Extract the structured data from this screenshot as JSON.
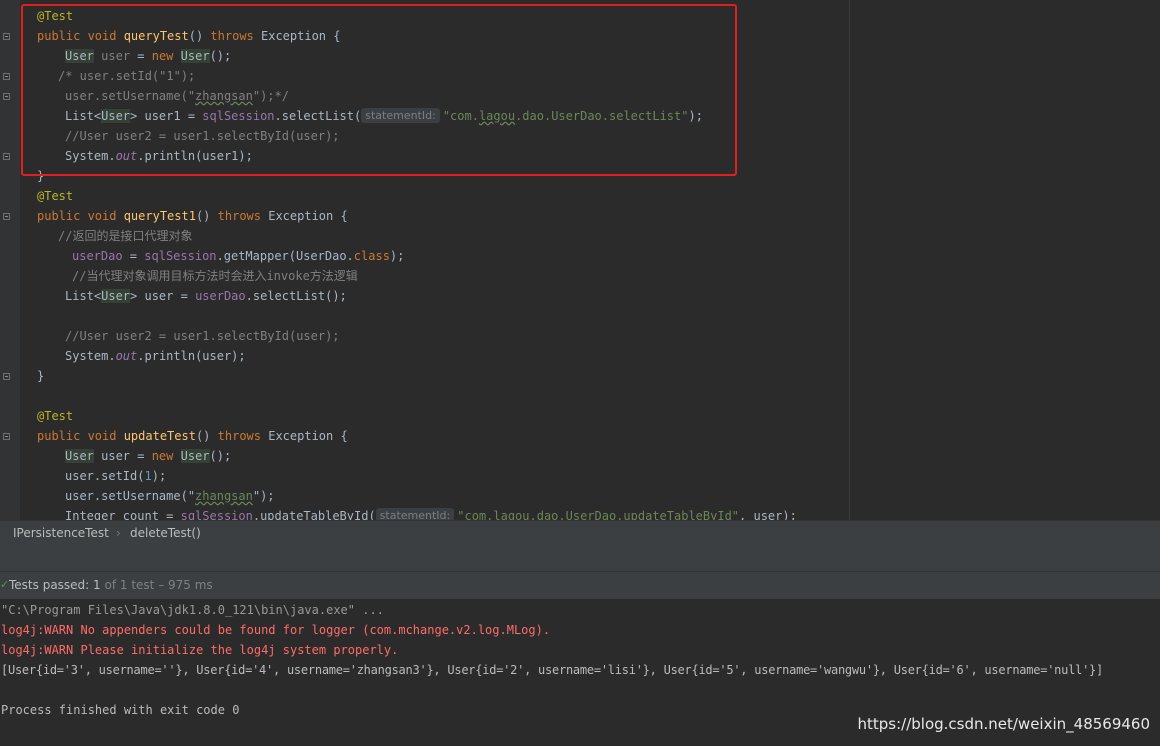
{
  "editor": {
    "lines": {
      "l0": {
        "ann": "@Test"
      },
      "l1": {
        "kw1": "public void ",
        "fn": "queryTest",
        "a": "() ",
        "kw2": "throws",
        "b": " Exception {"
      },
      "l2": {
        "t1": "User",
        "sp": " ",
        "v": "user",
        "eq": " = ",
        "kw": "new",
        "sp2": " ",
        "t2": "User",
        "end": "();"
      },
      "l3": {
        "c": "/* user.setId(\"1\");"
      },
      "l4": {
        "c1": "user.setUsername(\"",
        "s": "zhangsan",
        "c2": "\");*/"
      },
      "l5": {
        "a": "List<",
        "t": "User",
        "b": "> user1 = ",
        "sq": "sqlSession",
        "c": ".selectList(",
        "hint": "statementId:",
        "q1": "\"",
        "s1": "com.",
        "s2": "lagou",
        "s3": ".dao.UserDao.selectList\"",
        "end": ");"
      },
      "l6": {
        "c": "//User user2 = user1.selectById(user);"
      },
      "l7": {
        "a": "System.",
        "f": "out",
        "b": ".println(user1);"
      },
      "l8": {
        "t": "}"
      },
      "l9": {
        "ann": "@Test"
      },
      "l10": {
        "kw1": "public void ",
        "fn": "queryTest1",
        "a": "() ",
        "kw2": "throws",
        "b": " Exception {"
      },
      "l11": {
        "c": "//返回的是接口代理对象"
      },
      "l12": {
        "v1": "userDao",
        "eq": " = ",
        "v2": "sqlSession",
        "m": ".getMapper(UserDao.",
        "kw": "class",
        "end": ");"
      },
      "l13": {
        "c": "//当代理对象调用目标方法时会进入invoke方法逻辑"
      },
      "l14": {
        "a": "List<",
        "t": "User",
        "b": "> user = ",
        "v": "userDao",
        "c": ".selectList();"
      },
      "l16": {
        "c": "//User user2 = user1.selectById(user);"
      },
      "l17": {
        "a": "System.",
        "f": "out",
        "b": ".println(user);"
      },
      "l18": {
        "t": "}"
      },
      "l20": {
        "ann": "@Test"
      },
      "l21": {
        "kw1": "public void ",
        "fn": "updateTest",
        "a": "() ",
        "kw2": "throws",
        "b": " Exception {"
      },
      "l22": {
        "t1": "User",
        "a": " user = ",
        "kw": "new",
        "sp": " ",
        "t2": "User",
        "end": "();"
      },
      "l23": {
        "a": "user.setId(",
        "n": "1",
        "end": ");"
      },
      "l24": {
        "a": "user.setUsername(\"",
        "s": "zhangsan",
        "end": "\");"
      },
      "l25": {
        "a": "Integer count = ",
        "sq": "sqlSession",
        "b": ".updateTableById(",
        "hint": "statementId:",
        "s1": "\"com.",
        "s2": "lagou",
        "s3": ".dao.UserDao.updateTableById\"",
        "end": ", user);"
      }
    }
  },
  "breadcrumb": {
    "class_name": "IPersistenceTest",
    "separator": "›",
    "method_name": "deleteTest()"
  },
  "tests": {
    "check_icon": "✓",
    "label": "Tests passed: ",
    "passed": "1",
    "total": "of 1 test",
    "dash": " – ",
    "time": "975 ms"
  },
  "console": {
    "line1": "\"C:\\Program Files\\Java\\jdk1.8.0_121\\bin\\java.exe\" ...",
    "line2": "log4j:WARN No appenders could be found for logger (com.mchange.v2.log.MLog).",
    "line3": "log4j:WARN Please initialize the log4j system properly.",
    "line4": "[User{id='3', username=''}, User{id='4', username='zhangsan3'}, User{id='2', username='lisi'}, User{id='5', username='wangwu'}, User{id='6', username='null'}]",
    "line6": "Process finished with exit code 0"
  },
  "watermark": "https://blog.csdn.net/weixin_48569460",
  "colors": {
    "annotation_box": "#e02020",
    "warn_text": "#ff6b68",
    "pass_green": "#499c54"
  }
}
